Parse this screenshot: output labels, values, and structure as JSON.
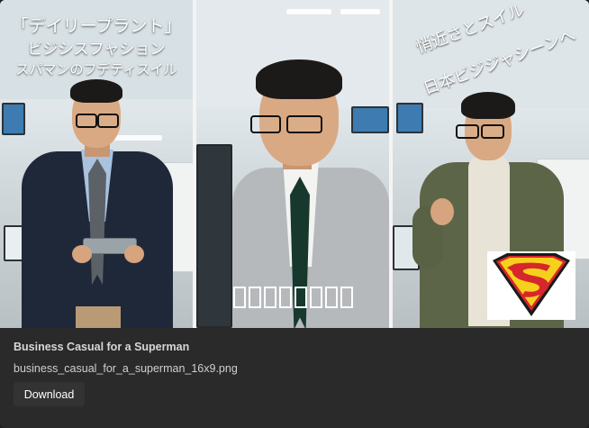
{
  "card": {
    "title": "Business Casual for a Superman",
    "filename": "business_casual_for_a_superman_16x9.png",
    "download_label": "Download"
  },
  "image": {
    "panel1_text": [
      "「デイリープラント」",
      "ビジシスフャション",
      "スパマンのフデティスイル"
    ],
    "panel3_text": [
      "悄近さとスイル",
      "日本ビジジャシーンへ"
    ],
    "logo_icon": "superman-s-shield-icon",
    "colors": {
      "logo_red": "#d7262c",
      "logo_yellow": "#f6d01c",
      "card_bg": "#2a2a2a"
    }
  }
}
